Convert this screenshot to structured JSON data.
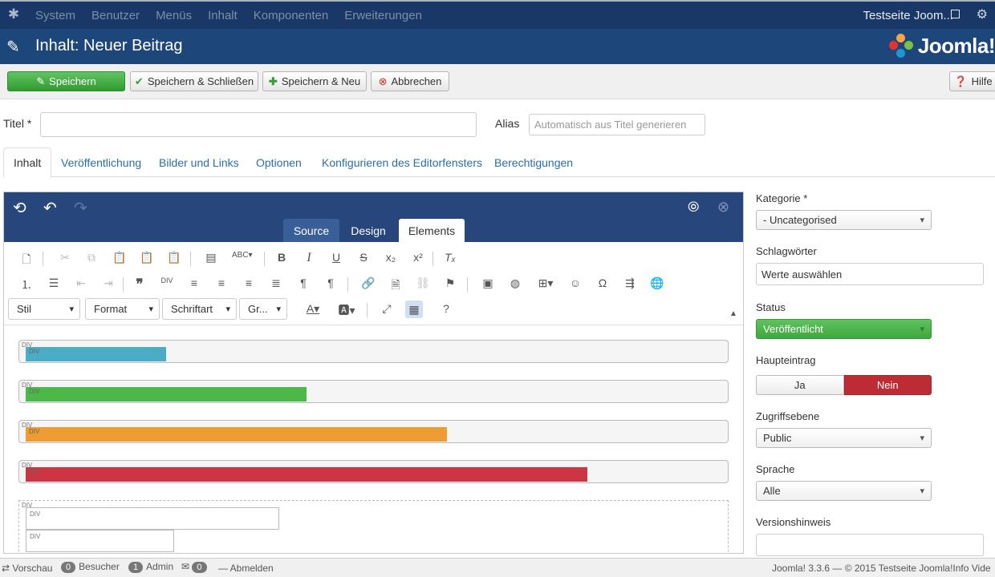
{
  "navbar": {
    "menu": [
      "System",
      "Benutzer",
      "Menüs",
      "Inhalt",
      "Komponenten",
      "Erweiterungen"
    ],
    "site_name": "Testseite Joom..."
  },
  "header": {
    "title": "Inhalt: Neuer Beitrag",
    "brand": "Joomla!"
  },
  "toolbar": {
    "save": "Speichern",
    "save_close": "Speichern & Schließen",
    "save_new": "Speichern & Neu",
    "cancel": "Abbrechen",
    "help": "Hilfe"
  },
  "form": {
    "title_label": "Titel *",
    "title_value": "",
    "alias_label": "Alias",
    "alias_placeholder": "Automatisch aus Titel generieren"
  },
  "tabs": [
    "Inhalt",
    "Veröffentlichung",
    "Bilder und Links",
    "Optionen",
    "Konfigurieren des Editorfensters",
    "Berechtigungen"
  ],
  "editor": {
    "tabs": [
      "Source",
      "Design",
      "Elements"
    ],
    "active_tab": "Elements",
    "dropdowns": [
      "Stil",
      "Format",
      "Schriftart",
      "Gr..."
    ],
    "div_tag": "DIV",
    "bars": [
      {
        "color": "#4bacc6",
        "fill": 0.2
      },
      {
        "color": "#4cb848",
        "fill": 0.4
      },
      {
        "color": "#ee9b32",
        "fill": 0.6
      },
      {
        "color": "#cc3542",
        "fill": 0.8
      }
    ]
  },
  "sidebar": {
    "kategorie_label": "Kategorie *",
    "kategorie_value": "- Uncategorised",
    "tags_label": "Schlagwörter",
    "tags_placeholder": "Werte auswählen",
    "status_label": "Status",
    "status_value": "Veröffentlicht",
    "featured_label": "Haupteintrag",
    "featured_yes": "Ja",
    "featured_no": "Nein",
    "access_label": "Zugriffsebene",
    "access_value": "Public",
    "language_label": "Sprache",
    "language_value": "Alle",
    "version_label": "Versionshinweis"
  },
  "statusbar": {
    "preview": "Vorschau",
    "visitors_count": "0",
    "visitors": "Besucher",
    "admin_count": "1",
    "admin": "Admin",
    "messages_count": "0",
    "logout": "Abmelden",
    "footer": "Joomla! 3.3.6  —  © 2015 Testseite Joomla!Info Vide"
  }
}
